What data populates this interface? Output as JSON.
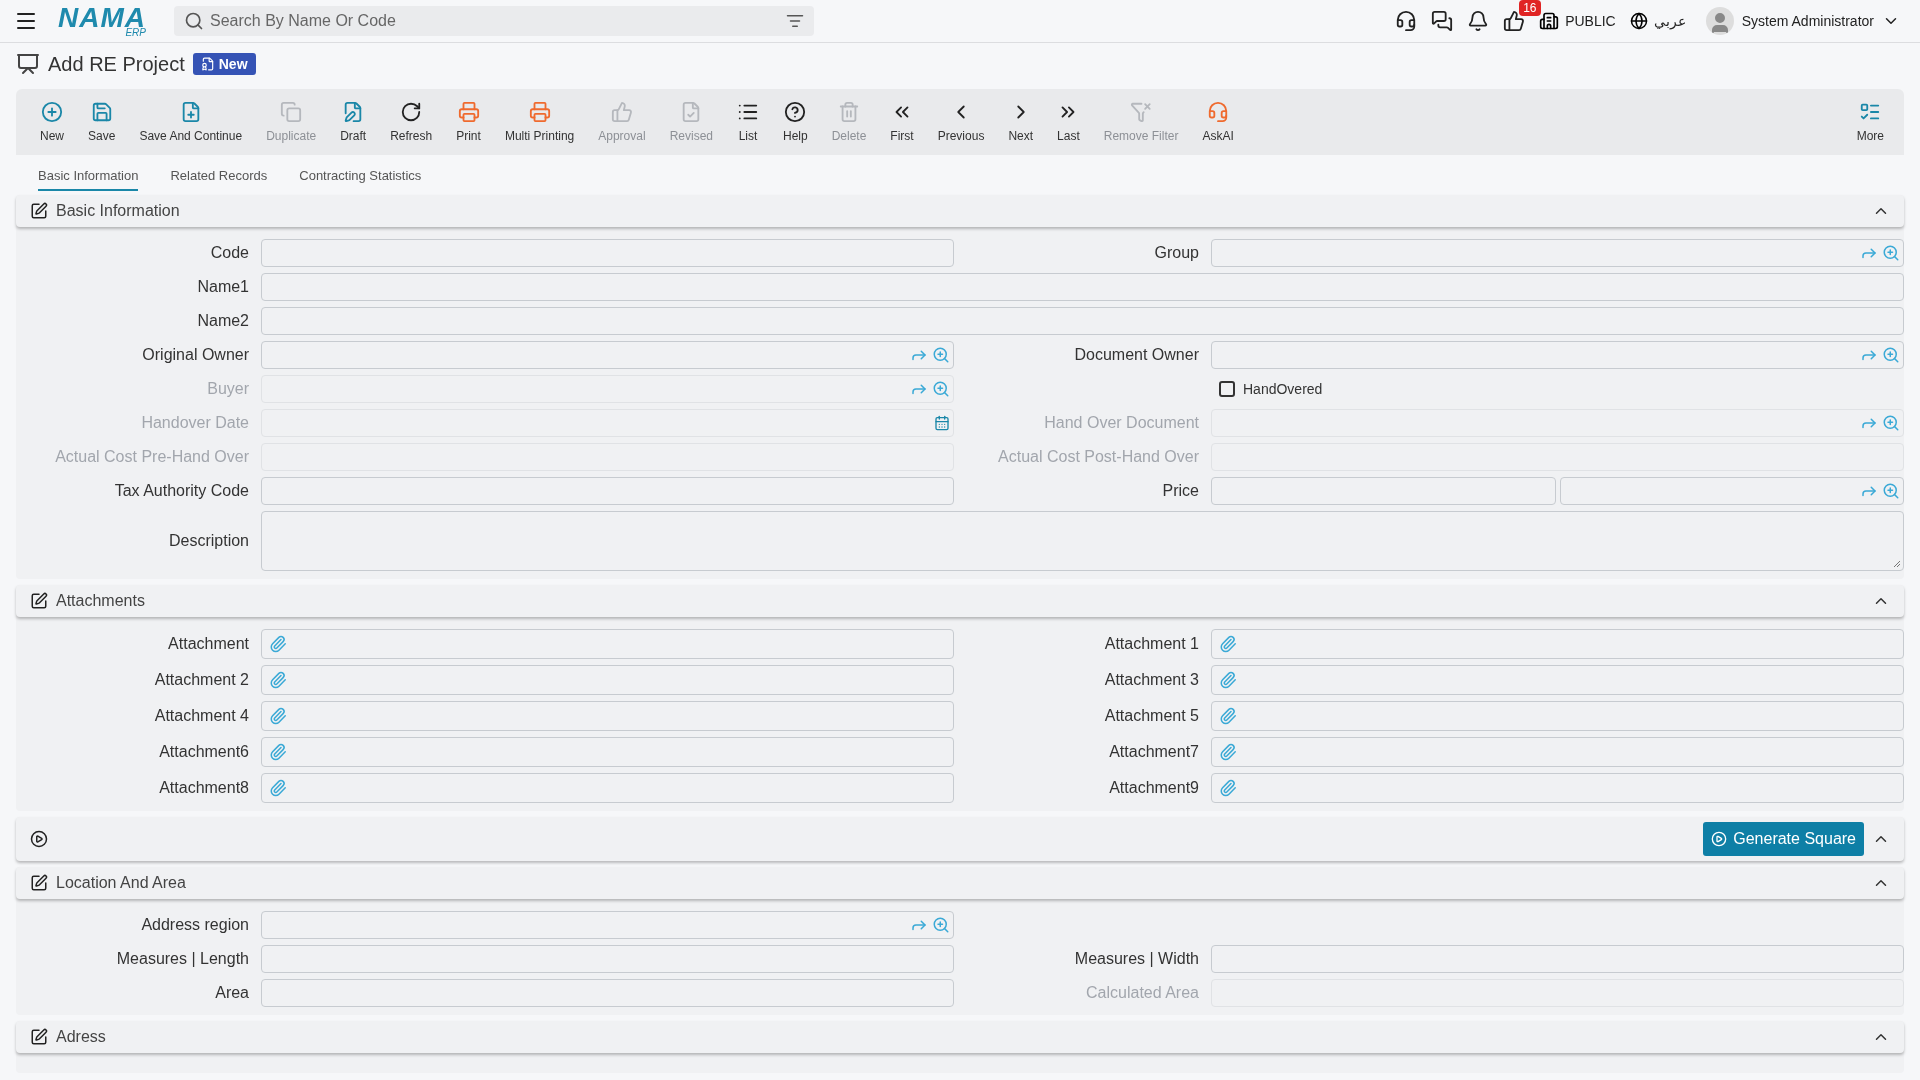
{
  "topbar": {
    "logo": {
      "name": "NAMA",
      "sub": "ERP"
    },
    "search": {
      "placeholder": "Search By Name Or Code"
    },
    "notifications": {
      "count": "16"
    },
    "company": "PUBLIC",
    "language": "عربي",
    "user": "System Administrator"
  },
  "page": {
    "title": "Add RE Project",
    "badge": "New"
  },
  "toolbar": [
    {
      "kind": "new",
      "label": "New",
      "disabled": false
    },
    {
      "kind": "save",
      "label": "Save",
      "disabled": false
    },
    {
      "kind": "savecontinue",
      "label": "Save And Continue",
      "disabled": false
    },
    {
      "kind": "duplicate",
      "label": "Duplicate",
      "disabled": true
    },
    {
      "kind": "draft",
      "label": "Draft",
      "disabled": false
    },
    {
      "kind": "refresh",
      "label": "Refresh",
      "disabled": false
    },
    {
      "kind": "print",
      "label": "Print",
      "disabled": false
    },
    {
      "kind": "multiprint",
      "label": "Multi Printing",
      "disabled": false
    },
    {
      "kind": "approval",
      "label": "Approval",
      "disabled": true
    },
    {
      "kind": "revised",
      "label": "Revised",
      "disabled": true
    },
    {
      "kind": "list",
      "label": "List",
      "disabled": false
    },
    {
      "kind": "help",
      "label": "Help",
      "disabled": false
    },
    {
      "kind": "delete",
      "label": "Delete",
      "disabled": true
    },
    {
      "kind": "first",
      "label": "First",
      "disabled": false
    },
    {
      "kind": "previous",
      "label": "Previous",
      "disabled": false
    },
    {
      "kind": "next",
      "label": "Next",
      "disabled": false
    },
    {
      "kind": "last",
      "label": "Last",
      "disabled": false
    },
    {
      "kind": "unfilter",
      "label": "Remove Filter",
      "disabled": true
    },
    {
      "kind": "askai",
      "label": "AskAI",
      "disabled": false
    },
    {
      "kind": "more",
      "label": "More",
      "disabled": false
    }
  ],
  "tabs": [
    {
      "label": "Basic Information",
      "selected": true
    },
    {
      "label": "Related Records",
      "selected": false
    },
    {
      "label": "Contracting Statistics",
      "selected": false
    }
  ],
  "sections": [
    {
      "kind": "form",
      "title": "Basic Information",
      "expanded": true,
      "rows": [
        {
          "kind": "pair",
          "left": {
            "label": "Code",
            "kind": "text",
            "disabled": false
          },
          "right": {
            "label": "Group",
            "kind": "lookup",
            "disabled": false
          }
        },
        {
          "kind": "full",
          "field": {
            "label": "Name1",
            "kind": "text",
            "disabled": false
          }
        },
        {
          "kind": "full",
          "field": {
            "label": "Name2",
            "kind": "text",
            "disabled": false
          }
        },
        {
          "kind": "pair",
          "left": {
            "label": "Original Owner",
            "kind": "lookup",
            "disabled": false
          },
          "right": {
            "label": "Document Owner",
            "kind": "lookup",
            "disabled": false
          }
        },
        {
          "kind": "pair",
          "left": {
            "label": "Buyer",
            "kind": "lookup",
            "disabled": true
          },
          "right": {
            "label": "HandOvered",
            "kind": "checkbox",
            "checked": false
          }
        },
        {
          "kind": "pair",
          "left": {
            "label": "Handover Date",
            "kind": "date",
            "disabled": true
          },
          "right": {
            "label": "Hand Over Document",
            "kind": "lookup",
            "disabled": true
          }
        },
        {
          "kind": "pair",
          "left": {
            "label": "Actual Cost Pre-Hand Over",
            "kind": "text",
            "disabled": true
          },
          "right": {
            "label": "Actual Cost Post-Hand Over",
            "kind": "text",
            "disabled": true
          }
        },
        {
          "kind": "pair",
          "left": {
            "label": "Tax Authority Code",
            "kind": "text",
            "disabled": false
          },
          "right": {
            "label": "Price",
            "kind": "price",
            "disabled": false
          }
        },
        {
          "kind": "full",
          "field": {
            "label": "Description",
            "kind": "textarea",
            "disabled": false
          }
        }
      ]
    },
    {
      "kind": "form",
      "title": "Attachments",
      "expanded": true,
      "rows": [
        {
          "kind": "pair",
          "left": {
            "label": "Attachment",
            "kind": "attachment",
            "disabled": false
          },
          "right": {
            "label": "Attachment 1",
            "kind": "attachment",
            "disabled": false
          }
        },
        {
          "kind": "pair",
          "left": {
            "label": "Attachment 2",
            "kind": "attachment",
            "disabled": false
          },
          "right": {
            "label": "Attachment 3",
            "kind": "attachment",
            "disabled": false
          }
        },
        {
          "kind": "pair",
          "left": {
            "label": "Attachment 4",
            "kind": "attachment",
            "disabled": false
          },
          "right": {
            "label": "Attachment 5",
            "kind": "attachment",
            "disabled": false
          }
        },
        {
          "kind": "pair",
          "left": {
            "label": "Attachment6",
            "kind": "attachment",
            "disabled": false
          },
          "right": {
            "label": "Attachment7",
            "kind": "attachment",
            "disabled": false
          }
        },
        {
          "kind": "pair",
          "left": {
            "label": "Attachment8",
            "kind": "attachment",
            "disabled": false
          },
          "right": {
            "label": "Attachment9",
            "kind": "attachment",
            "disabled": false
          }
        }
      ]
    },
    {
      "kind": "action",
      "button": "Generate Square",
      "expanded": true
    },
    {
      "kind": "form",
      "title": "Location And Area",
      "expanded": true,
      "rows": [
        {
          "kind": "single",
          "field": {
            "label": "Address region",
            "kind": "lookup",
            "disabled": false
          }
        },
        {
          "kind": "pair",
          "left": {
            "label": "Measures | Length",
            "kind": "text",
            "disabled": false
          },
          "right": {
            "label": "Measures | Width",
            "kind": "text",
            "disabled": false
          }
        },
        {
          "kind": "pair",
          "left": {
            "label": "Area",
            "kind": "text",
            "disabled": false
          },
          "right": {
            "label": "Calculated Area",
            "kind": "text",
            "disabled": true
          }
        }
      ]
    },
    {
      "kind": "form",
      "title": "Adress",
      "expanded": true
    }
  ]
}
